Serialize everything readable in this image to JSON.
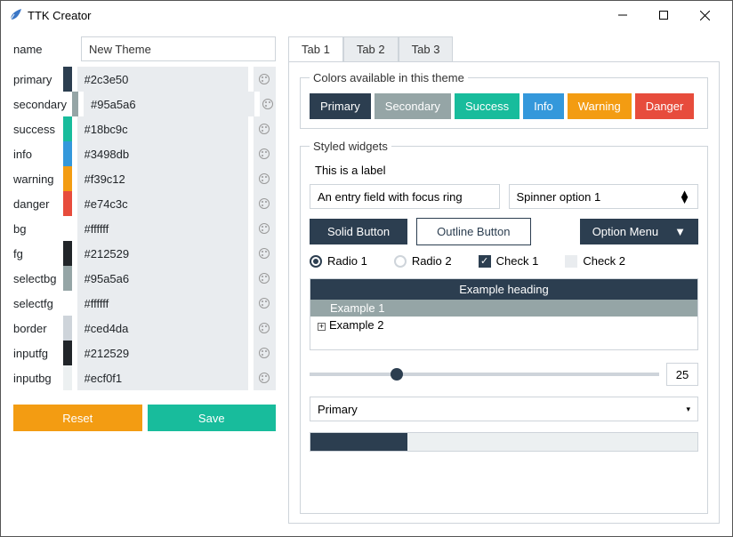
{
  "window": {
    "title": "TTK Creator"
  },
  "left": {
    "name_label": "name",
    "name_value": "New Theme",
    "colors": [
      {
        "key": "primary",
        "hex": "#2c3e50"
      },
      {
        "key": "secondary",
        "hex": "#95a5a6"
      },
      {
        "key": "success",
        "hex": "#18bc9c"
      },
      {
        "key": "info",
        "hex": "#3498db"
      },
      {
        "key": "warning",
        "hex": "#f39c12"
      },
      {
        "key": "danger",
        "hex": "#e74c3c"
      },
      {
        "key": "bg",
        "hex": "#ffffff"
      },
      {
        "key": "fg",
        "hex": "#212529"
      },
      {
        "key": "selectbg",
        "hex": "#95a5a6"
      },
      {
        "key": "selectfg",
        "hex": "#ffffff"
      },
      {
        "key": "border",
        "hex": "#ced4da"
      },
      {
        "key": "inputfg",
        "hex": "#212529"
      },
      {
        "key": "inputbg",
        "hex": "#ecf0f1"
      }
    ],
    "reset": "Reset",
    "save": "Save"
  },
  "right": {
    "tabs": [
      "Tab 1",
      "Tab 2",
      "Tab 3"
    ],
    "colors_legend": "Colors available in this theme",
    "color_buttons": [
      {
        "label": "Primary",
        "bg": "#2c3e50"
      },
      {
        "label": "Secondary",
        "bg": "#95a5a6"
      },
      {
        "label": "Success",
        "bg": "#18bc9c"
      },
      {
        "label": "Info",
        "bg": "#3498db"
      },
      {
        "label": "Warning",
        "bg": "#f39c12"
      },
      {
        "label": "Danger",
        "bg": "#e74c3c"
      }
    ],
    "styled_legend": "Styled widgets",
    "label_text": "This is a label",
    "entry_value": "An entry field with focus ring",
    "spinner_value": "Spinner option 1",
    "solid_button": "Solid Button",
    "outline_button": "Outline Button",
    "option_menu": "Option Menu",
    "radio1": "Radio 1",
    "radio2": "Radio 2",
    "check1": "Check 1",
    "check2": "Check 2",
    "tree_heading": "Example heading",
    "tree_row1": "Example 1",
    "tree_row2": "Example 2",
    "slider_value": "25",
    "combo_value": "Primary",
    "progress_percent": 25
  }
}
